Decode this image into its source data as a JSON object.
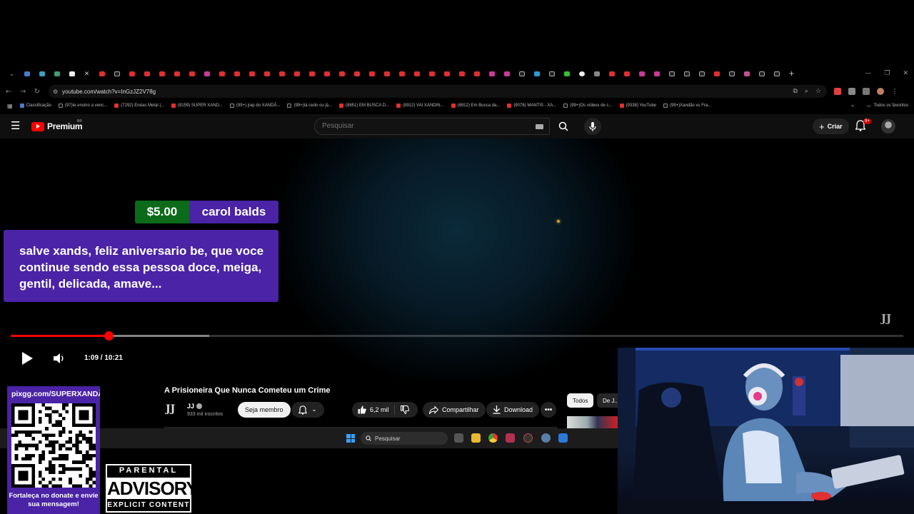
{
  "browser": {
    "url": "youtube.com/watch?v=InGzJZ2V78g",
    "bookmarks": [
      {
        "label": "Classificação",
        "color": "#4a7bd0"
      },
      {
        "label": "(97)Ie ensino a venc...",
        "color": "#111"
      },
      {
        "label": "(7292) Enéas Metal |...",
        "color": "#e03030"
      },
      {
        "label": "(8159) SUPER XAND...",
        "color": "#e03030"
      },
      {
        "label": "(99+) jrap do XANDÃ...",
        "color": "#111"
      },
      {
        "label": "(99+)tá cedo ou já...",
        "color": "#111"
      },
      {
        "label": "(8851) EM BUSCA D...",
        "color": "#e03030"
      },
      {
        "label": "(8912) VAI XANDIN...",
        "color": "#e03030"
      },
      {
        "label": "(8912) Em Busca da...",
        "color": "#e03030"
      },
      {
        "label": "(9078) MANTIS - XA...",
        "color": "#e03030"
      },
      {
        "label": "(99+)Os vídeos de c...",
        "color": "#111"
      },
      {
        "label": "(9338) YouTube",
        "color": "#e03030"
      },
      {
        "label": "(99+)Xandão vs Fra...",
        "color": "#111"
      }
    ],
    "all_bookmarks": "Todos os favoritos"
  },
  "header": {
    "logo_text": "Premium",
    "logo_country": "BR",
    "search_placeholder": "Pesquisar",
    "create_label": "Criar",
    "notif_count": "9+"
  },
  "donation": {
    "amount": "$5.00",
    "name": "carol balds",
    "message": "salve xands, feliz aniversario be, que voce continue sendo essa pessoa doce, meiga, gentil, delicada, amave..."
  },
  "player": {
    "watermark": "JJ",
    "time": "1:09 / 10:21",
    "progress": 0.11,
    "buffered": 0.222
  },
  "video": {
    "title": "A Prisioneira Que Nunca Cometeu um Crime",
    "channel_logo": "JJ",
    "channel_name": "JJ",
    "subscribers": "933 mil inscritos",
    "join_label": "Seja membro",
    "likes": "6,2 mil",
    "share_label": "Compartilhar",
    "download_label": "Download",
    "more_label": "•••"
  },
  "chips": {
    "all": "Todos",
    "second": "De J..."
  },
  "taskbar": {
    "search_placeholder": "Pesquisar"
  },
  "overlay": {
    "pix_url": "pixgg.com/SUPERXANDÃO",
    "pix_caption": "Fortaleça no donate e envie sua mensagem!",
    "advisory_top": "PARENTAL",
    "advisory_mid": "ADVISORY",
    "advisory_bot": "EXPLICIT CONTENT"
  },
  "colors": {
    "donation_purple": "#4a23a6",
    "donation_green": "#0b6b1a",
    "progress_red": "#ff0000",
    "yt_bg": "#0f0f0f"
  }
}
